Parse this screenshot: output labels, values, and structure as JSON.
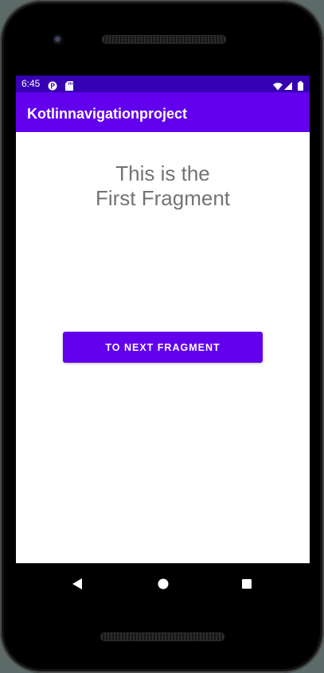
{
  "status_bar": {
    "time": "6:45",
    "notification_icons": [
      "notification-icon",
      "sd-card-icon"
    ],
    "system_icons": [
      "wifi-icon",
      "signal-icon",
      "battery-icon"
    ]
  },
  "app_bar": {
    "title": "Kotlinnavigationproject"
  },
  "fragment": {
    "text": "This is the\nFirst Fragment"
  },
  "actions": {
    "next_button_label": "TO NEXT FRAGMENT"
  },
  "navigation_bar": {
    "buttons": [
      "back-icon",
      "home-icon",
      "recents-icon"
    ]
  },
  "colors": {
    "status_bar": "#3700B3",
    "app_bar": "#6200EE",
    "button": "#6200EE",
    "text": "#737373"
  }
}
